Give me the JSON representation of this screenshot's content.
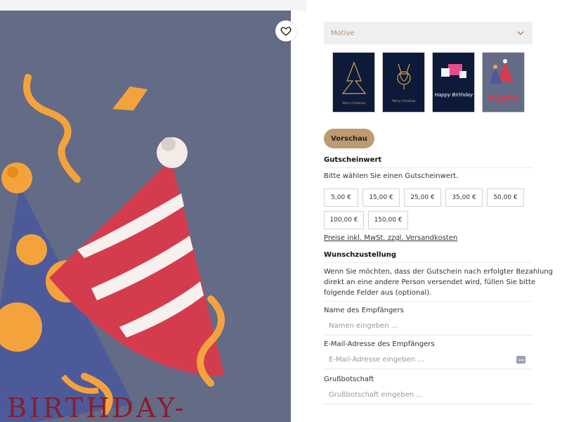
{
  "select": {
    "label": "Motive"
  },
  "thumbnails": [
    {
      "name": "christmas-tree-motif"
    },
    {
      "name": "reindeer-motif"
    },
    {
      "name": "happy-birthday-motif"
    },
    {
      "name": "party-motif"
    }
  ],
  "thumb_text": {
    "t1": "Merry Christmas",
    "t2": "Merry Christmas",
    "t3": "Happy Birthday",
    "t4": "PaRTY"
  },
  "preview_button": "Vorschau",
  "voucher": {
    "heading": "Gutscheinwert",
    "instruction": "Bitte wählen Sie einen Gutscheinwert.",
    "amounts": [
      "5,00 €",
      "15,00 €",
      "25,00 €",
      "35,00 €",
      "50,00 €",
      "100,00 €",
      "150,00 €"
    ],
    "price_note": "Preise inkl. MwSt. zzgl. Versandkosten"
  },
  "delivery": {
    "heading": "Wunschzustellung",
    "desc_line1": "Wenn Sie möchten, dass der Gutschein nach erfolgter Bezahlung",
    "desc_line2": "direkt an eine andere Person versendet wird, füllen Sie bitte",
    "desc_line3": "folgende Felder aus (optional).",
    "recipient_name_label": "Name des Empfängers",
    "recipient_name_placeholder": "Namen eingeben ...",
    "recipient_email_label": "E-Mail-Adresse des Empfängers",
    "recipient_email_placeholder": "E-Mail-Adresse eingeben ...",
    "greeting_label": "Grußbotschaft",
    "greeting_placeholder": "Grußbotschaft eingeben ..."
  },
  "hero_text": "BIRTHDAY-",
  "colors": {
    "accent": "#be9a73",
    "hero_bg": "#646b86",
    "select_text": "#b8906a"
  }
}
